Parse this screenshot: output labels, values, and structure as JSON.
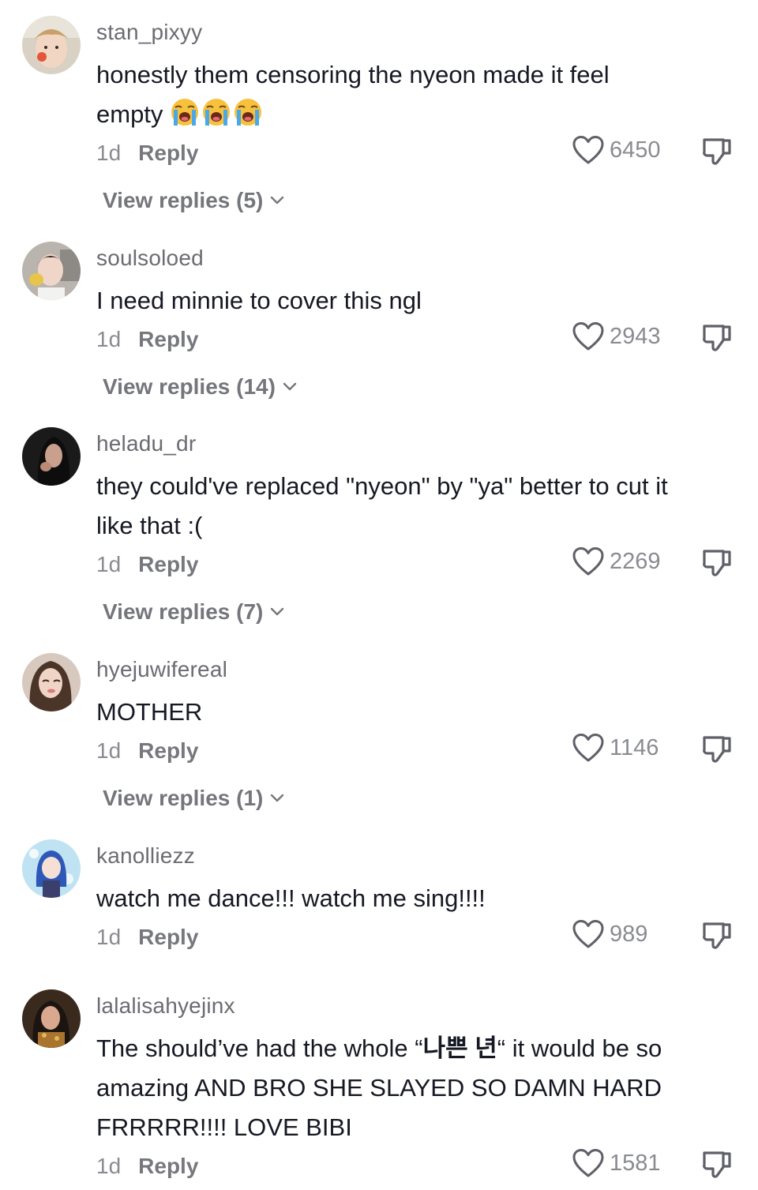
{
  "comments": [
    {
      "username": "stan_pixyy",
      "text_lines": [
        "honestly them censoring the nyeon made it feel",
        "empty"
      ],
      "emojis": [
        "loudly-crying-face",
        "loudly-crying-face",
        "loudly-crying-face"
      ],
      "time": "1d",
      "reply_label": "Reply",
      "likes": "6450",
      "view_replies": "View replies (5)"
    },
    {
      "username": "soulsoloed",
      "text_lines": [
        "I need minnie to cover this ngl"
      ],
      "time": "1d",
      "reply_label": "Reply",
      "likes": "2943",
      "view_replies": "View replies (14)"
    },
    {
      "username": "heladu_dr",
      "text_lines": [
        "they could've replaced \"nyeon\" by \"ya\" better to cut it",
        "like that :("
      ],
      "time": "1d",
      "reply_label": "Reply",
      "likes": "2269",
      "view_replies": "View replies (7)"
    },
    {
      "username": "hyejuwifereal",
      "text_lines": [
        "MOTHER"
      ],
      "time": "1d",
      "reply_label": "Reply",
      "likes": "1146",
      "view_replies": "View replies (1)"
    },
    {
      "username": "kanolliezz",
      "text_lines": [
        "watch me dance!!! watch me sing!!!!"
      ],
      "time": "1d",
      "reply_label": "Reply",
      "likes": "989"
    },
    {
      "username": "lalalisahyejinx",
      "text_line1_pre": "The should’ve had the whole “",
      "text_line1_korean": "나쁜 년",
      "text_line1_post": "“ it would be so",
      "text_lines_rest": [
        "amazing AND BRO SHE SLAYED SO DAMN HARD",
        "FRRRRR!!!! LOVE BIBI"
      ],
      "time": "1d",
      "reply_label": "Reply",
      "likes": "1581"
    }
  ],
  "icons": {
    "like": "heart-outline-icon",
    "dislike": "thumbs-down-icon",
    "expand": "chevron-down-icon"
  },
  "colors": {
    "text": "#161823",
    "secondary": "#8a8b91",
    "username": "#6b6b72"
  }
}
